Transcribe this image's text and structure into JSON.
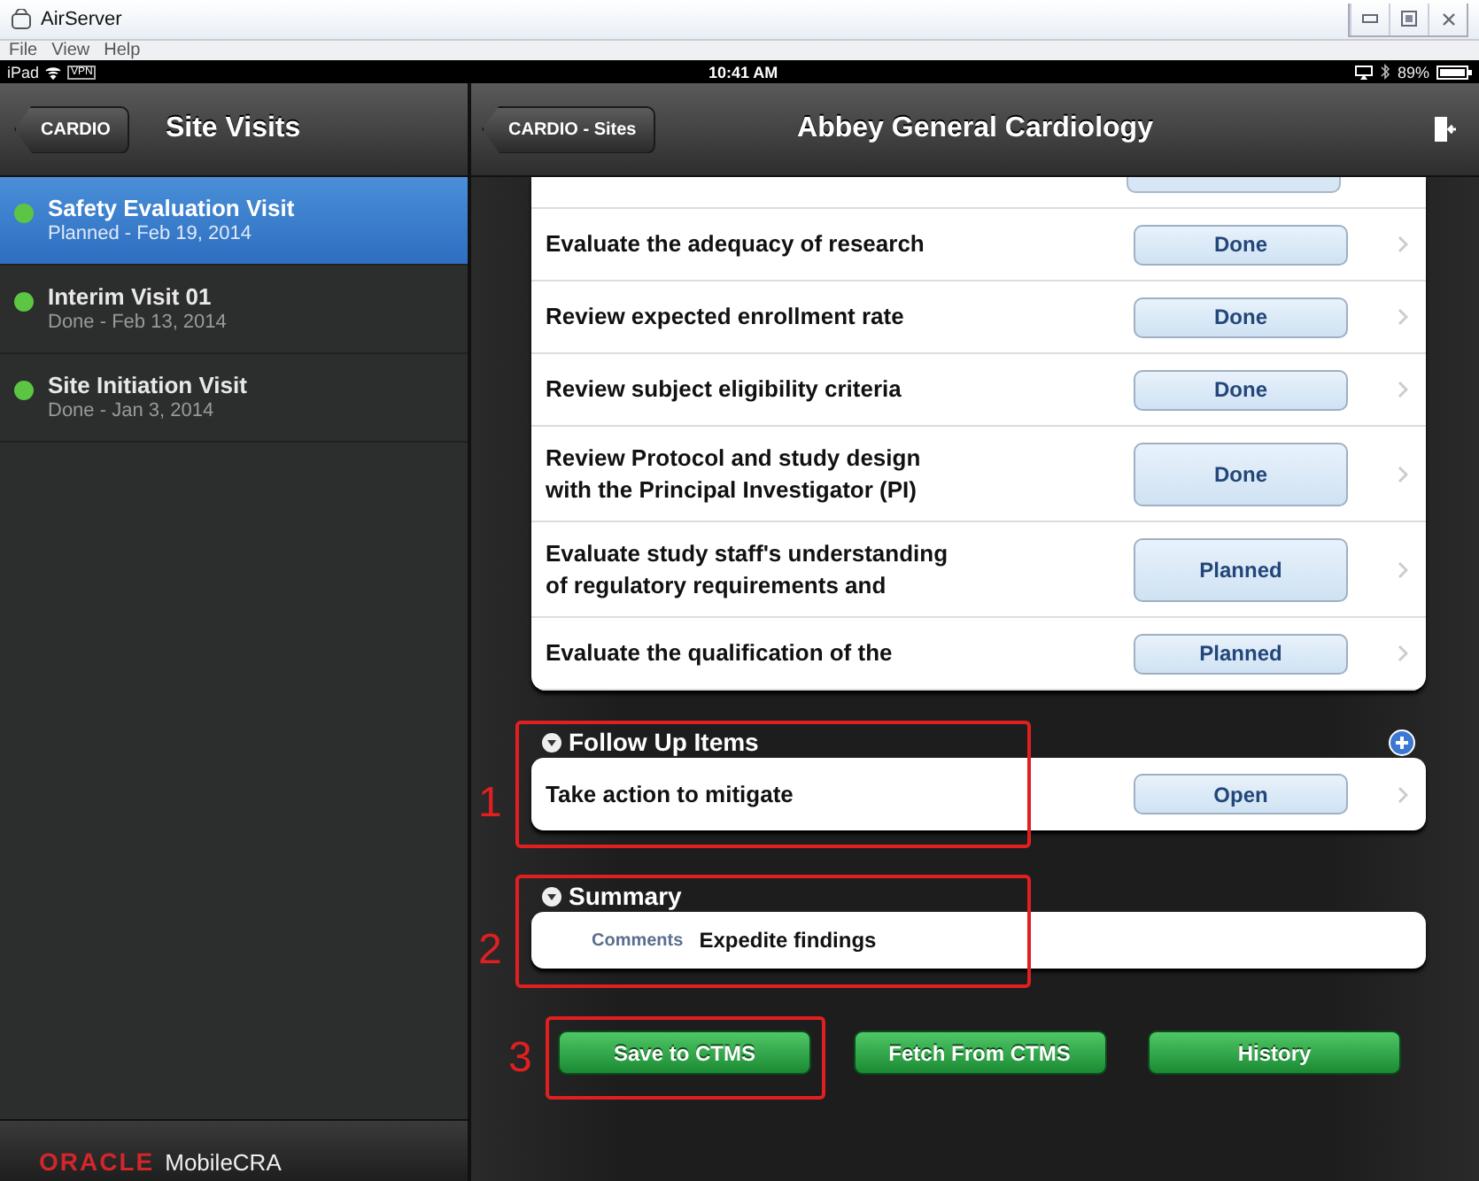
{
  "window": {
    "title": "AirServer",
    "menu": [
      "File",
      "View",
      "Help"
    ]
  },
  "status_bar": {
    "device": "iPad",
    "vpn": "VPN",
    "time": "10:41 AM",
    "battery": "89%"
  },
  "sidebar": {
    "back": "CARDIO",
    "title": "Site Visits",
    "items": [
      {
        "title": "Safety Evaluation Visit",
        "subtitle": "Planned - Feb 19, 2014",
        "selected": true,
        "color": "#5cc644"
      },
      {
        "title": "Interim Visit 01",
        "subtitle": "Done - Feb 13, 2014",
        "selected": false,
        "color": "#5cc644"
      },
      {
        "title": "Site Initiation Visit",
        "subtitle": "Done - Jan 3, 2014",
        "selected": false,
        "color": "#5cc644"
      }
    ],
    "footer": {
      "brand": "ORACLE",
      "product": "MobileCRA"
    }
  },
  "detail": {
    "back": "CARDIO - Sites",
    "title": "Abbey General Cardiology",
    "tasks": [
      {
        "label": "Evaluate the adequacy of research",
        "status": "Done"
      },
      {
        "label": "Review expected enrollment rate",
        "status": "Done"
      },
      {
        "label": "Review subject eligibility criteria",
        "status": "Done"
      },
      {
        "label": "Review Protocol and study design\nwith the Principal Investigator (PI)",
        "status": "Done"
      },
      {
        "label": "Evaluate study staff's understanding\nof regulatory requirements and",
        "status": "Planned"
      },
      {
        "label": "Evaluate the qualification of the",
        "status": "Planned"
      }
    ],
    "follow_up": {
      "title": "Follow Up Items",
      "expanded": true,
      "items": [
        {
          "label": "Take action to mitigate",
          "status": "Open"
        }
      ]
    },
    "summary": {
      "title": "Summary",
      "expanded": true,
      "field_label": "Comments",
      "value": "Expedite findings"
    },
    "buttons": [
      "Save to CTMS",
      "Fetch From CTMS",
      "History"
    ]
  },
  "annotations": [
    {
      "number": "1"
    },
    {
      "number": "2"
    },
    {
      "number": "3"
    }
  ]
}
